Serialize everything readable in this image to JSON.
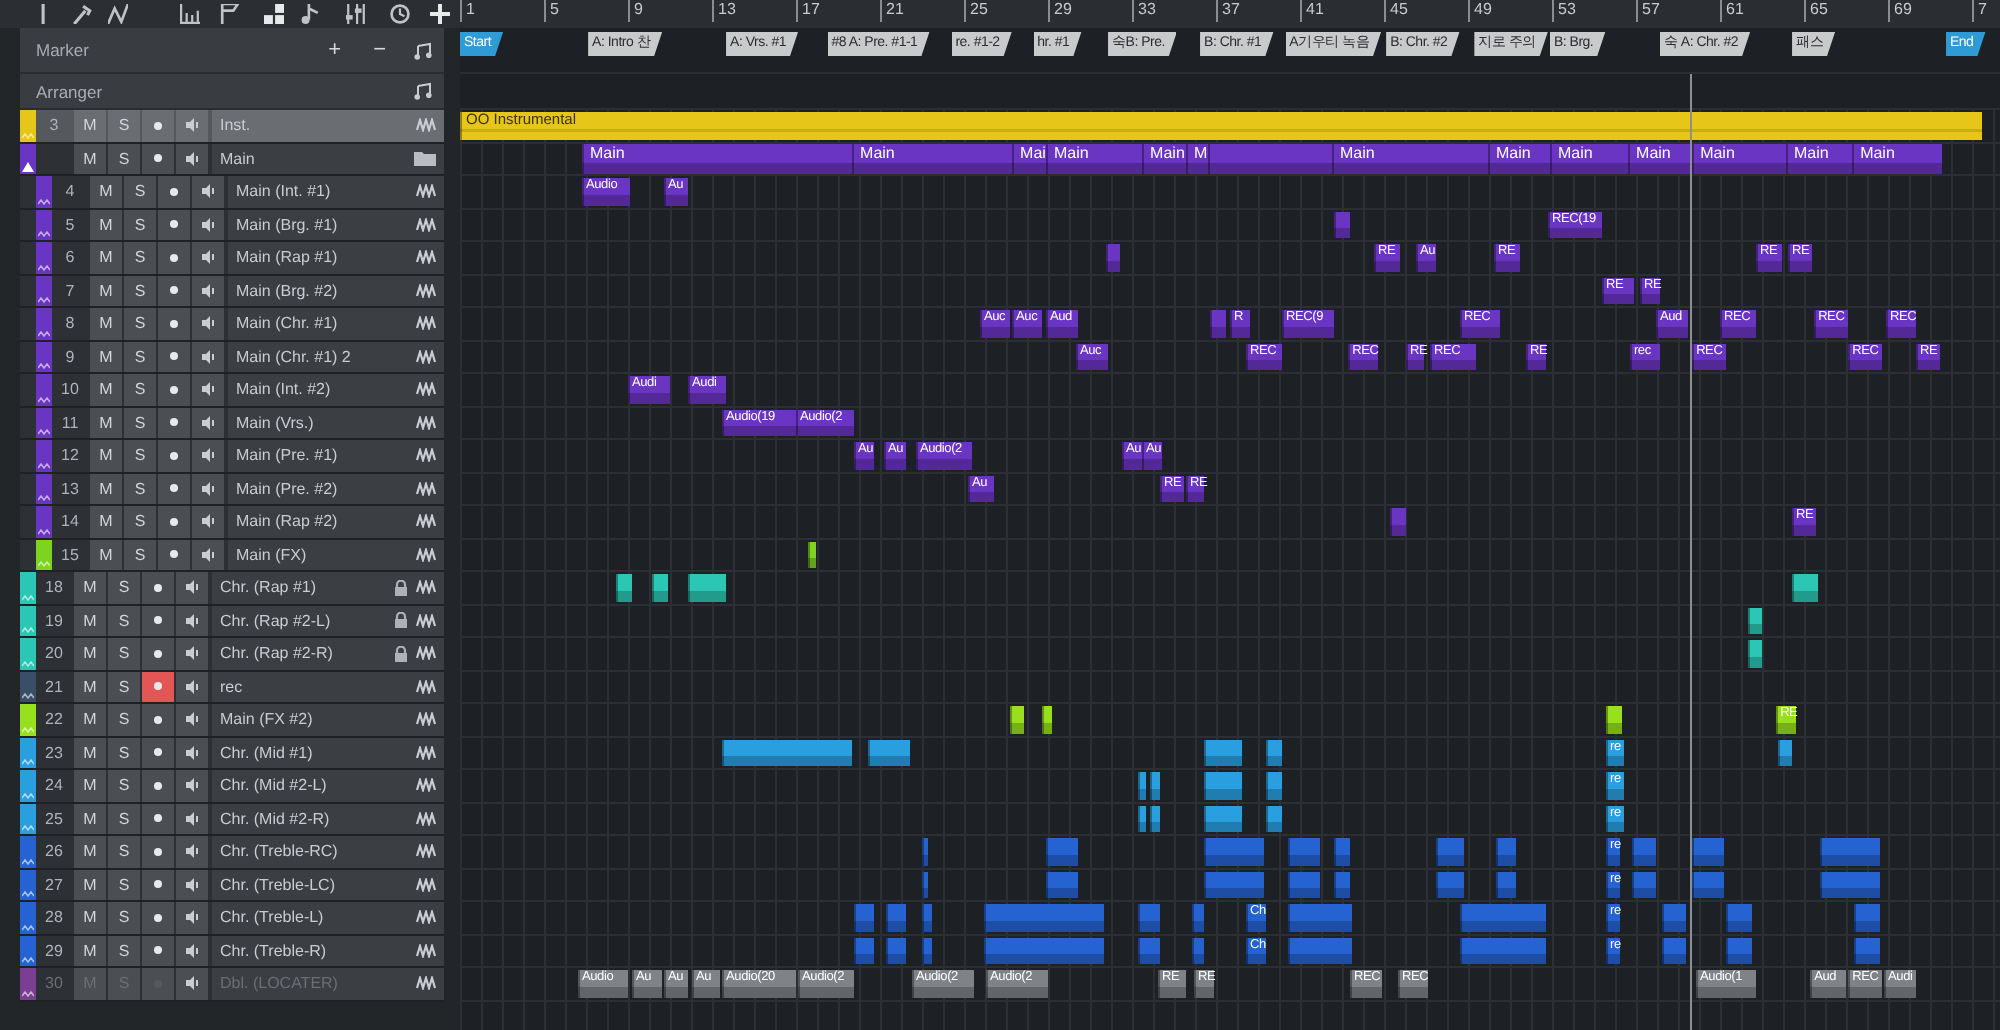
{
  "marker_header": {
    "title": "Marker",
    "add": "+",
    "remove": "−"
  },
  "arranger_header": {
    "title": "Arranger"
  },
  "ruler": [
    "1",
    "5",
    "9",
    "13",
    "17",
    "21",
    "25",
    "29",
    "33",
    "37",
    "41",
    "45",
    "49",
    "53",
    "57",
    "61",
    "65",
    "69",
    "7"
  ],
  "markers": [
    {
      "kind": "start",
      "label": "Start"
    },
    {
      "kind": "marker",
      "label": "A: Intro 찬"
    },
    {
      "kind": "marker",
      "label": "A: Vrs. #1"
    },
    {
      "kind": "marker",
      "label": "#8 A: Pre. #1-1"
    },
    {
      "kind": "marker",
      "label": "re. #1-2"
    },
    {
      "kind": "marker",
      "label": "hr. #1"
    },
    {
      "kind": "marker",
      "label": "숙B: Pre."
    },
    {
      "kind": "marker",
      "label": "B: Chr. #1"
    },
    {
      "kind": "marker",
      "label": "A기우티 녹음"
    },
    {
      "kind": "marker",
      "label": "B: Chr. #2"
    },
    {
      "kind": "marker",
      "label": "지로 주의"
    },
    {
      "kind": "marker",
      "label": "B: Brg."
    },
    {
      "kind": "marker",
      "label": "숙 A: Chr. #2"
    },
    {
      "kind": "marker",
      "label": "패스"
    },
    {
      "kind": "end",
      "label": "End"
    }
  ],
  "tracks": [
    {
      "kind": "instrument",
      "number": "3",
      "name": "Inst.",
      "color": "#e6c619",
      "mute": "M",
      "solo": "S",
      "selected": true,
      "armed": false,
      "locked": false,
      "disabled": false,
      "clip_labels": [
        "OO Instrumental"
      ]
    },
    {
      "kind": "folder",
      "name": "Main",
      "color": "#6a35c2",
      "mute": "M",
      "solo": "S",
      "selected": false,
      "armed": false,
      "locked": false,
      "disabled": false,
      "expanded": true,
      "clip_labels": [
        "Main",
        "Main",
        "Mai",
        "Main",
        "Main",
        "M",
        "Main",
        "Main",
        "Main",
        "Main",
        "Main",
        "Main",
        "Main"
      ],
      "children": [
        {
          "kind": "audio",
          "number": "4",
          "name": "Main (Int. #1)",
          "color": "#6a35c2",
          "mute": "M",
          "solo": "S",
          "selected": false,
          "armed": false,
          "locked": false,
          "disabled": false,
          "clip_labels": [
            "Audio",
            "Au"
          ]
        },
        {
          "kind": "audio",
          "number": "5",
          "name": "Main (Brg. #1)",
          "color": "#6a35c2",
          "mute": "M",
          "solo": "S",
          "selected": false,
          "armed": false,
          "locked": false,
          "disabled": false,
          "clip_labels": [
            "REC(19"
          ]
        },
        {
          "kind": "audio",
          "number": "6",
          "name": "Main (Rap #1)",
          "color": "#6a35c2",
          "mute": "M",
          "solo": "S",
          "selected": false,
          "armed": false,
          "locked": false,
          "disabled": false,
          "clip_labels": [
            "RE",
            "Au",
            "RE",
            "RE",
            "RE"
          ]
        },
        {
          "kind": "audio",
          "number": "7",
          "name": "Main (Brg. #2)",
          "color": "#6a35c2",
          "mute": "M",
          "solo": "S",
          "selected": false,
          "armed": false,
          "locked": false,
          "disabled": false,
          "clip_labels": [
            "RE",
            "RE"
          ]
        },
        {
          "kind": "audio",
          "number": "8",
          "name": "Main (Chr. #1)",
          "color": "#6a35c2",
          "mute": "M",
          "solo": "S",
          "selected": false,
          "armed": false,
          "locked": false,
          "disabled": false,
          "clip_labels": [
            "Auc",
            "Auc",
            "Aud",
            "R",
            "REC(9",
            "REC",
            "Aud",
            "REC",
            "REC",
            "REC"
          ]
        },
        {
          "kind": "audio",
          "number": "9",
          "name": "Main (Chr. #1) 2",
          "color": "#6a35c2",
          "mute": "M",
          "solo": "S",
          "selected": false,
          "armed": false,
          "locked": false,
          "disabled": false,
          "clip_labels": [
            "Auc",
            "REC",
            "REC",
            "RE",
            "REC",
            "RE",
            "rec",
            "REC",
            "REC",
            "RE"
          ]
        },
        {
          "kind": "audio",
          "number": "10",
          "name": "Main (Int. #2)",
          "color": "#6a35c2",
          "mute": "M",
          "solo": "S",
          "selected": false,
          "armed": false,
          "locked": false,
          "disabled": false,
          "clip_labels": [
            "Audi",
            "Audi"
          ]
        },
        {
          "kind": "audio",
          "number": "11",
          "name": "Main (Vrs.)",
          "color": "#6a35c2",
          "mute": "M",
          "solo": "S",
          "selected": false,
          "armed": false,
          "locked": false,
          "disabled": false,
          "clip_labels": [
            "Audio(19",
            "Audio(2"
          ]
        },
        {
          "kind": "audio",
          "number": "12",
          "name": "Main (Pre. #1)",
          "color": "#6a35c2",
          "mute": "M",
          "solo": "S",
          "selected": false,
          "armed": false,
          "locked": false,
          "disabled": false,
          "clip_labels": [
            "Au",
            "Au",
            "Audio(2",
            "Au",
            "Au"
          ]
        },
        {
          "kind": "audio",
          "number": "13",
          "name": "Main (Pre. #2)",
          "color": "#6a35c2",
          "mute": "M",
          "solo": "S",
          "selected": false,
          "armed": false,
          "locked": false,
          "disabled": false,
          "clip_labels": [
            "Au",
            "RE",
            "RE"
          ]
        },
        {
          "kind": "audio",
          "number": "14",
          "name": "Main (Rap #2)",
          "color": "#6a35c2",
          "mute": "M",
          "solo": "S",
          "selected": false,
          "armed": false,
          "locked": false,
          "disabled": false,
          "clip_labels": [
            "RE"
          ]
        },
        {
          "kind": "audio",
          "number": "15",
          "name": "Main (FX)",
          "color": "#7ed321",
          "mute": "M",
          "solo": "S",
          "selected": false,
          "armed": false,
          "locked": false,
          "disabled": false
        }
      ]
    },
    {
      "kind": "audio",
      "number": "18",
      "name": "Chr. (Rap #1)",
      "color": "#2cc7b4",
      "mute": "M",
      "solo": "S",
      "selected": false,
      "armed": false,
      "locked": true,
      "disabled": false
    },
    {
      "kind": "audio",
      "number": "19",
      "name": "Chr. (Rap #2-L)",
      "color": "#2cc7b4",
      "mute": "M",
      "solo": "S",
      "selected": false,
      "armed": false,
      "locked": true,
      "disabled": false
    },
    {
      "kind": "audio",
      "number": "20",
      "name": "Chr. (Rap #2-R)",
      "color": "#2cc7b4",
      "mute": "M",
      "solo": "S",
      "selected": false,
      "armed": false,
      "locked": true,
      "disabled": false
    },
    {
      "kind": "audio",
      "number": "21",
      "name": "rec",
      "color": "#3a4e68",
      "mute": "M",
      "solo": "S",
      "selected": false,
      "armed": true,
      "locked": false,
      "disabled": false
    },
    {
      "kind": "audio",
      "number": "22",
      "name": "Main (FX #2)",
      "color": "#98e01e",
      "mute": "M",
      "solo": "S",
      "selected": false,
      "armed": false,
      "locked": false,
      "disabled": false,
      "clip_labels": [
        "RE"
      ]
    },
    {
      "kind": "audio",
      "number": "23",
      "name": "Chr. (Mid #1)",
      "color": "#2a9fe0",
      "mute": "M",
      "solo": "S",
      "selected": false,
      "armed": false,
      "locked": false,
      "disabled": false,
      "clip_labels": [
        "re"
      ]
    },
    {
      "kind": "audio",
      "number": "24",
      "name": "Chr. (Mid #2-L)",
      "color": "#2a9fe0",
      "mute": "M",
      "solo": "S",
      "selected": false,
      "armed": false,
      "locked": false,
      "disabled": false,
      "clip_labels": [
        "re"
      ]
    },
    {
      "kind": "audio",
      "number": "25",
      "name": "Chr. (Mid #2-R)",
      "color": "#2a9fe0",
      "mute": "M",
      "solo": "S",
      "selected": false,
      "armed": false,
      "locked": false,
      "disabled": false,
      "clip_labels": [
        "re"
      ]
    },
    {
      "kind": "audio",
      "number": "26",
      "name": "Chr. (Treble-RC)",
      "color": "#2563d2",
      "mute": "M",
      "solo": "S",
      "selected": false,
      "armed": false,
      "locked": false,
      "disabled": false,
      "clip_labels": [
        "re"
      ]
    },
    {
      "kind": "audio",
      "number": "27",
      "name": "Chr. (Treble-LC)",
      "color": "#2563d2",
      "mute": "M",
      "solo": "S",
      "selected": false,
      "armed": false,
      "locked": false,
      "disabled": false,
      "clip_labels": [
        "re"
      ]
    },
    {
      "kind": "audio",
      "number": "28",
      "name": "Chr. (Treble-L)",
      "color": "#2563d2",
      "mute": "M",
      "solo": "S",
      "selected": false,
      "armed": false,
      "locked": false,
      "disabled": false,
      "clip_labels": [
        "Ch",
        "re"
      ]
    },
    {
      "kind": "audio",
      "number": "29",
      "name": "Chr. (Treble-R)",
      "color": "#2563d2",
      "mute": "M",
      "solo": "S",
      "selected": false,
      "armed": false,
      "locked": false,
      "disabled": false,
      "clip_labels": [
        "Ch",
        "re"
      ]
    },
    {
      "kind": "audio",
      "number": "30",
      "name": "Dbl. (LOCATER)",
      "color": "#7a3f92",
      "mute": "M",
      "solo": "S",
      "selected": false,
      "armed": false,
      "locked": false,
      "disabled": true,
      "clip_labels": [
        "Audio",
        "Au",
        "Au",
        "Au",
        "Audio(20",
        "Audio(2",
        "Audio(2",
        "Audio(2",
        "RE",
        "RE",
        "REC",
        "REC",
        "Audio(1",
        "Aud",
        "REC",
        "Audi"
      ]
    }
  ]
}
